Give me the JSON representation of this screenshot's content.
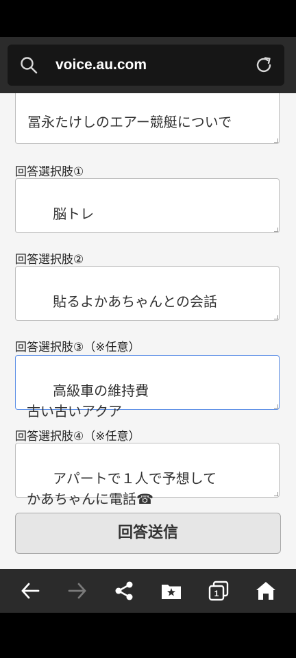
{
  "browser": {
    "url": "voice.au.com"
  },
  "form": {
    "question_text": "冨永たけしのエアー競艇についで",
    "fields": [
      {
        "label": "回答選択肢①",
        "value": "脳トレ"
      },
      {
        "label": "回答選択肢②",
        "value": "貼るよかあちゃんとの会話"
      },
      {
        "label": "回答選択肢③（※任意）",
        "value": "高級車の維持費\n古い古いアクア"
      },
      {
        "label": "回答選択肢④（※任意）",
        "value": "アパートで１人で予想して\nかあちゃんに電話☎"
      }
    ],
    "submit_label": "回答送信"
  },
  "toolbar": {
    "icons": [
      "back-arrow-icon",
      "forward-arrow-icon",
      "share-icon",
      "bookmarks-icon",
      "tabs-icon",
      "home-icon"
    ],
    "tab_count": "1"
  },
  "colors": {
    "toolbar_bg": "#2b2b2b",
    "page_bg": "#f5f5f5",
    "focus_border": "#5b8ee6"
  }
}
